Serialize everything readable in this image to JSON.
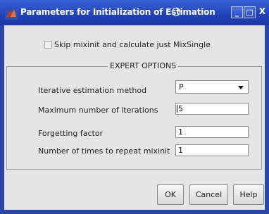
{
  "window": {
    "title": "Parameters for Initialization of Estimation",
    "minimize_label": "_",
    "maximize_label": "□",
    "close_label": "X"
  },
  "skip": {
    "label": "Skip mixinit and calculate just MixSingle",
    "checked": false
  },
  "expert": {
    "title": "EXPERT OPTIONS",
    "method_label": "Iterative estimation method",
    "method_value": "P",
    "max_iter_label": "Maximum number of iterations",
    "max_iter_value": "5",
    "forgetting_label": "Forgetting factor",
    "forgetting_value": "1",
    "repeat_label": "Number of times to repeat mixinit",
    "repeat_value": "1"
  },
  "buttons": {
    "ok": "OK",
    "cancel": "Cancel",
    "help": "Help"
  },
  "colors": {
    "titlebar": "#2142b8",
    "window_border": "#2a46a8",
    "dialog_bg": "#e5e5e5"
  }
}
